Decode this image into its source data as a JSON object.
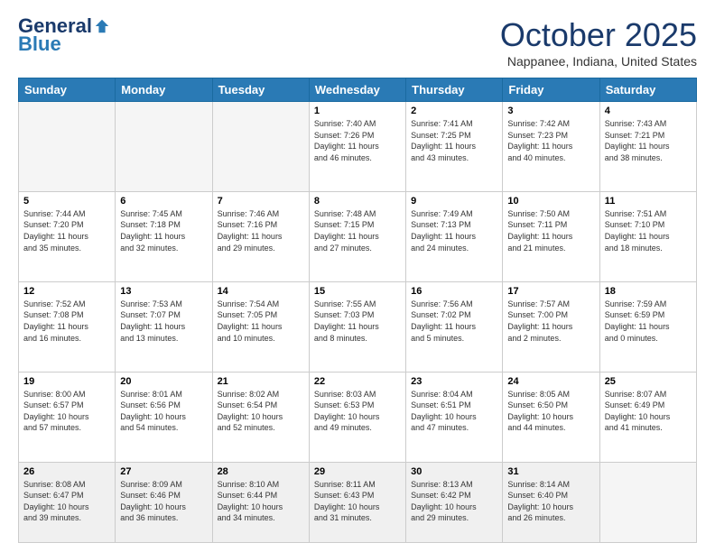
{
  "logo": {
    "general": "General",
    "blue": "Blue"
  },
  "header": {
    "month": "October 2025",
    "location": "Nappanee, Indiana, United States"
  },
  "weekdays": [
    "Sunday",
    "Monday",
    "Tuesday",
    "Wednesday",
    "Thursday",
    "Friday",
    "Saturday"
  ],
  "weeks": [
    [
      {
        "day": "",
        "info": "",
        "empty": true
      },
      {
        "day": "",
        "info": "",
        "empty": true
      },
      {
        "day": "",
        "info": "",
        "empty": true
      },
      {
        "day": "1",
        "info": "Sunrise: 7:40 AM\nSunset: 7:26 PM\nDaylight: 11 hours\nand 46 minutes."
      },
      {
        "day": "2",
        "info": "Sunrise: 7:41 AM\nSunset: 7:25 PM\nDaylight: 11 hours\nand 43 minutes."
      },
      {
        "day": "3",
        "info": "Sunrise: 7:42 AM\nSunset: 7:23 PM\nDaylight: 11 hours\nand 40 minutes."
      },
      {
        "day": "4",
        "info": "Sunrise: 7:43 AM\nSunset: 7:21 PM\nDaylight: 11 hours\nand 38 minutes."
      }
    ],
    [
      {
        "day": "5",
        "info": "Sunrise: 7:44 AM\nSunset: 7:20 PM\nDaylight: 11 hours\nand 35 minutes."
      },
      {
        "day": "6",
        "info": "Sunrise: 7:45 AM\nSunset: 7:18 PM\nDaylight: 11 hours\nand 32 minutes."
      },
      {
        "day": "7",
        "info": "Sunrise: 7:46 AM\nSunset: 7:16 PM\nDaylight: 11 hours\nand 29 minutes."
      },
      {
        "day": "8",
        "info": "Sunrise: 7:48 AM\nSunset: 7:15 PM\nDaylight: 11 hours\nand 27 minutes."
      },
      {
        "day": "9",
        "info": "Sunrise: 7:49 AM\nSunset: 7:13 PM\nDaylight: 11 hours\nand 24 minutes."
      },
      {
        "day": "10",
        "info": "Sunrise: 7:50 AM\nSunset: 7:11 PM\nDaylight: 11 hours\nand 21 minutes."
      },
      {
        "day": "11",
        "info": "Sunrise: 7:51 AM\nSunset: 7:10 PM\nDaylight: 11 hours\nand 18 minutes."
      }
    ],
    [
      {
        "day": "12",
        "info": "Sunrise: 7:52 AM\nSunset: 7:08 PM\nDaylight: 11 hours\nand 16 minutes."
      },
      {
        "day": "13",
        "info": "Sunrise: 7:53 AM\nSunset: 7:07 PM\nDaylight: 11 hours\nand 13 minutes."
      },
      {
        "day": "14",
        "info": "Sunrise: 7:54 AM\nSunset: 7:05 PM\nDaylight: 11 hours\nand 10 minutes."
      },
      {
        "day": "15",
        "info": "Sunrise: 7:55 AM\nSunset: 7:03 PM\nDaylight: 11 hours\nand 8 minutes."
      },
      {
        "day": "16",
        "info": "Sunrise: 7:56 AM\nSunset: 7:02 PM\nDaylight: 11 hours\nand 5 minutes."
      },
      {
        "day": "17",
        "info": "Sunrise: 7:57 AM\nSunset: 7:00 PM\nDaylight: 11 hours\nand 2 minutes."
      },
      {
        "day": "18",
        "info": "Sunrise: 7:59 AM\nSunset: 6:59 PM\nDaylight: 11 hours\nand 0 minutes."
      }
    ],
    [
      {
        "day": "19",
        "info": "Sunrise: 8:00 AM\nSunset: 6:57 PM\nDaylight: 10 hours\nand 57 minutes."
      },
      {
        "day": "20",
        "info": "Sunrise: 8:01 AM\nSunset: 6:56 PM\nDaylight: 10 hours\nand 54 minutes."
      },
      {
        "day": "21",
        "info": "Sunrise: 8:02 AM\nSunset: 6:54 PM\nDaylight: 10 hours\nand 52 minutes."
      },
      {
        "day": "22",
        "info": "Sunrise: 8:03 AM\nSunset: 6:53 PM\nDaylight: 10 hours\nand 49 minutes."
      },
      {
        "day": "23",
        "info": "Sunrise: 8:04 AM\nSunset: 6:51 PM\nDaylight: 10 hours\nand 47 minutes."
      },
      {
        "day": "24",
        "info": "Sunrise: 8:05 AM\nSunset: 6:50 PM\nDaylight: 10 hours\nand 44 minutes."
      },
      {
        "day": "25",
        "info": "Sunrise: 8:07 AM\nSunset: 6:49 PM\nDaylight: 10 hours\nand 41 minutes."
      }
    ],
    [
      {
        "day": "26",
        "info": "Sunrise: 8:08 AM\nSunset: 6:47 PM\nDaylight: 10 hours\nand 39 minutes.",
        "lastrow": true
      },
      {
        "day": "27",
        "info": "Sunrise: 8:09 AM\nSunset: 6:46 PM\nDaylight: 10 hours\nand 36 minutes.",
        "lastrow": true
      },
      {
        "day": "28",
        "info": "Sunrise: 8:10 AM\nSunset: 6:44 PM\nDaylight: 10 hours\nand 34 minutes.",
        "lastrow": true
      },
      {
        "day": "29",
        "info": "Sunrise: 8:11 AM\nSunset: 6:43 PM\nDaylight: 10 hours\nand 31 minutes.",
        "lastrow": true
      },
      {
        "day": "30",
        "info": "Sunrise: 8:13 AM\nSunset: 6:42 PM\nDaylight: 10 hours\nand 29 minutes.",
        "lastrow": true
      },
      {
        "day": "31",
        "info": "Sunrise: 8:14 AM\nSunset: 6:40 PM\nDaylight: 10 hours\nand 26 minutes.",
        "lastrow": true
      },
      {
        "day": "",
        "info": "",
        "empty": true,
        "lastrow": true
      }
    ]
  ]
}
